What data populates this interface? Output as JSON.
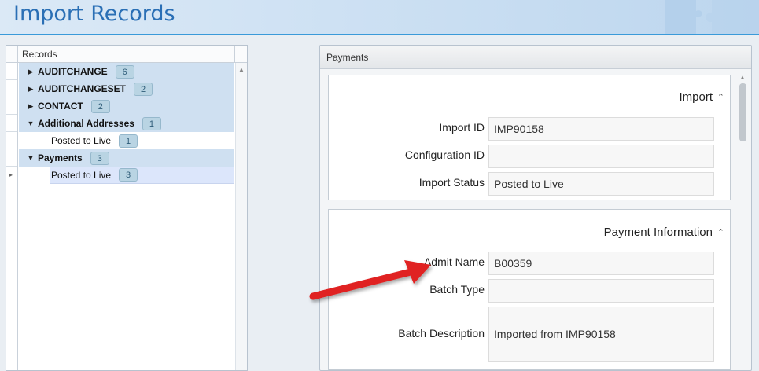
{
  "header": {
    "title": "Import Records"
  },
  "tree": {
    "column_header": "Records",
    "items": [
      {
        "label": "AUDITCHANGE",
        "count": "6",
        "expanded": false,
        "level": 0
      },
      {
        "label": "AUDITCHANGESET",
        "count": "2",
        "expanded": false,
        "level": 0
      },
      {
        "label": "CONTACT",
        "count": "2",
        "expanded": false,
        "level": 0
      },
      {
        "label": "Additional Addresses",
        "count": "1",
        "expanded": true,
        "level": 0
      },
      {
        "label": "Posted to Live",
        "count": "1",
        "level": 1
      },
      {
        "label": "Payments",
        "count": "3",
        "expanded": true,
        "level": 0
      },
      {
        "label": "Posted to Live",
        "count": "3",
        "level": 1,
        "selected": true
      }
    ]
  },
  "panel": {
    "title": "Payments",
    "import_section": {
      "title": "Import",
      "fields": [
        {
          "label": "Import ID",
          "value": "IMP90158"
        },
        {
          "label": "Configuration ID",
          "value": ""
        },
        {
          "label": "Import Status",
          "value": "Posted to Live"
        }
      ]
    },
    "payment_section": {
      "title": "Payment Information",
      "fields": [
        {
          "label": "Admit Name",
          "value": "B00359"
        },
        {
          "label": "Batch Type",
          "value": ""
        },
        {
          "label": "Batch Description",
          "value": "Imported from IMP90158"
        }
      ]
    }
  },
  "icons": {
    "collapsed": "triangle-right-icon",
    "expanded": "triangle-down-icon",
    "section_collapse": "chevron-up-icon",
    "annotation": "red-arrow-icon"
  },
  "colors": {
    "accent": "#2a6fb5",
    "header_border": "#3a9ad9",
    "parent_row": "#cfe0f1",
    "selected_row": "#dce6fb",
    "badge": "#b9d4e3",
    "annotation_arrow": "#e02020"
  }
}
